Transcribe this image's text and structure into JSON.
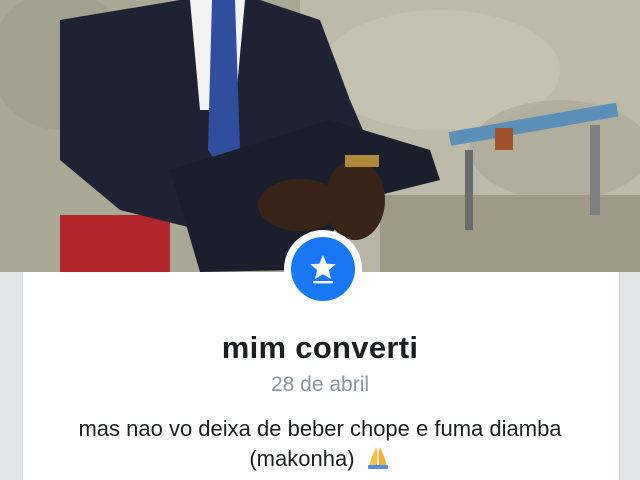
{
  "event": {
    "title": "mim converti",
    "date": "28 de abril",
    "caption_line1": "mas nao vo deixa de beber chope e fuma diamba",
    "caption_line2": "(makonha)",
    "icon": "life-event-star-icon",
    "emoji_icon": "praying-hands-icon"
  },
  "colors": {
    "accent": "#1877f2",
    "title": "#1c1e21",
    "date": "#8d949e"
  }
}
